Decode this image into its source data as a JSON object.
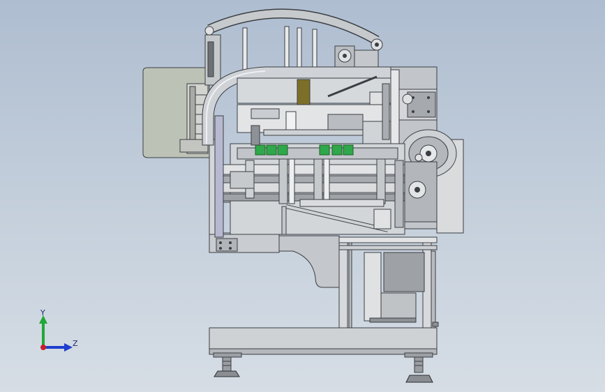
{
  "viewport": {
    "background_top": "#aebdd0",
    "background_bottom": "#d6dde5"
  },
  "model": {
    "colors": {
      "metal_light": "#e3e5e7",
      "metal_mid": "#c9ccd0",
      "metal_dark": "#8e9297",
      "outline": "#3b3e42",
      "panel": "#bcc3b6",
      "accent_green": "#2ea84a",
      "accent_olive": "#7c7028"
    }
  },
  "triad": {
    "y_label": "Y",
    "z_label": "Z",
    "y_color": "#21a838",
    "z_color": "#1f3fcf",
    "origin_color": "#c8202a"
  }
}
